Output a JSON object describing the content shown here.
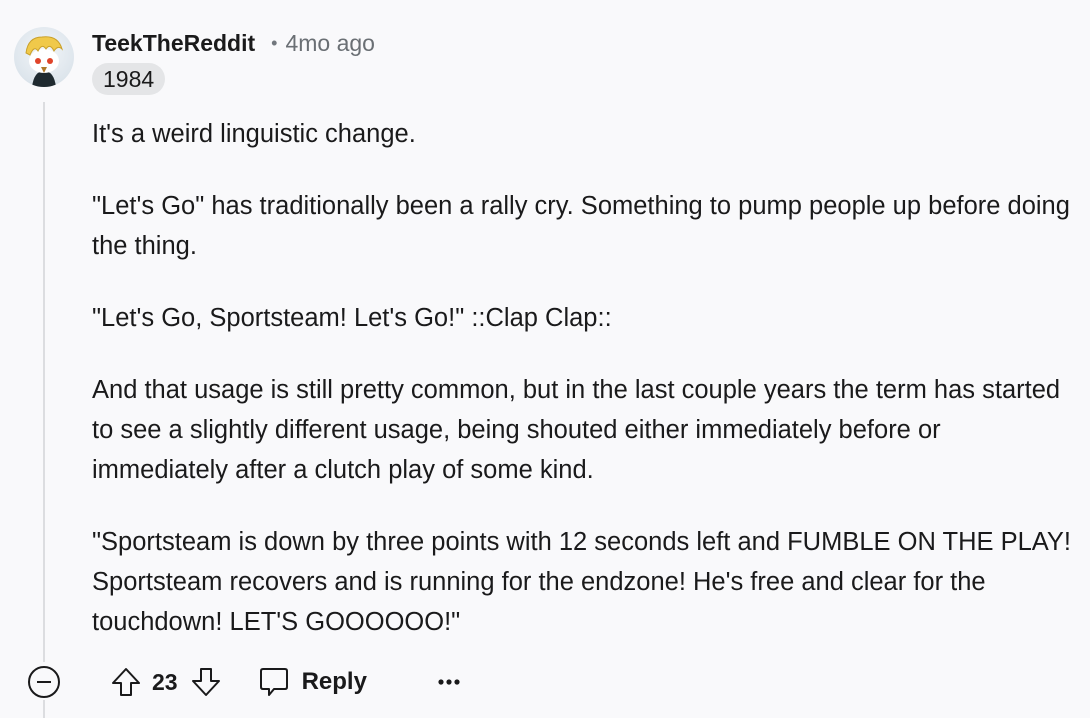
{
  "comment": {
    "username": "TeekTheReddit",
    "separator": "•",
    "timestamp": "4mo ago",
    "flair": "1984",
    "paragraphs": [
      "It's a weird linguistic change.",
      "\"Let's Go\" has traditionally been a rally cry. Something to pump people up before doing the thing.",
      "\"Let's Go, Sportsteam! Let's Go!\" ::Clap Clap::",
      "And that usage is still pretty common, but in the last couple years the term has started to see a slightly different usage, being shouted either immediately before or immediately after a clutch play of some kind.",
      "\"Sportsteam is down by three points with 12 seconds left and FUMBLE ON THE PLAY! Sportsteam recovers and is running for the endzone! He's free and clear for the touchdown! LET'S GOOOOOO!\""
    ]
  },
  "actions": {
    "vote_count": "23",
    "reply_label": "Reply",
    "icons": {
      "collapse": "collapse-icon",
      "upvote": "upvote-icon",
      "downvote": "downvote-icon",
      "reply": "comment-icon",
      "more": "more-options-icon"
    }
  }
}
